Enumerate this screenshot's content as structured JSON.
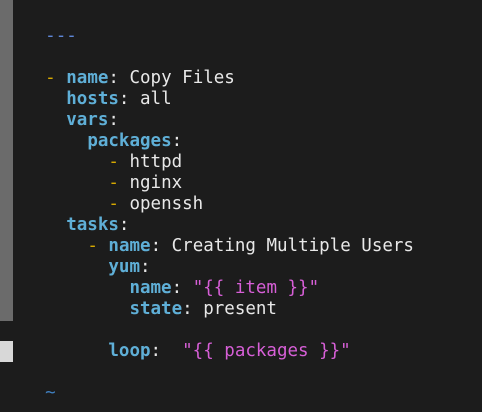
{
  "editor": {
    "doc_start": "---",
    "fold_marker": "-",
    "key_name": "name",
    "play_name": "Copy Files",
    "key_hosts": "hosts",
    "hosts_value": "all",
    "key_vars": "vars",
    "key_packages": "packages",
    "packages": [
      "httpd",
      "nginx",
      "openssh"
    ],
    "key_tasks": "tasks",
    "task_name_key": "name",
    "task_name": "Creating Multiple Users",
    "key_yum": "yum",
    "key_yum_name": "name",
    "yum_name_value": "\"{{ item }}\"",
    "key_state": "state",
    "state_value": "present",
    "key_loop": "loop",
    "loop_value": "\"{{ packages }}\"",
    "empty_line_marker": "~",
    "colors": {
      "background": "#1c1c1c",
      "key": "#5fafd7",
      "dash": "#d7a900",
      "string": "#d75fd7",
      "text": "#e8e8e8",
      "tilde": "#3f7fbf"
    }
  }
}
